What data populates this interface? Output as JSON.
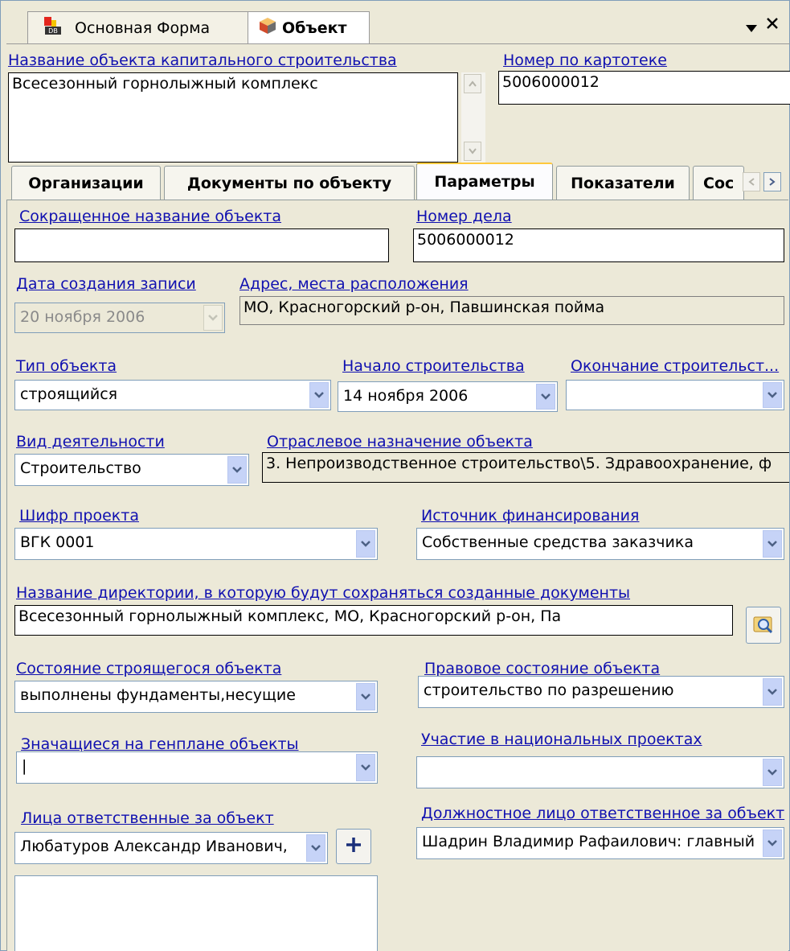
{
  "doc_tabs": [
    {
      "label": "Основная Форма",
      "icon": "database-form-icon"
    },
    {
      "label": "Объект",
      "icon": "cube-icon"
    }
  ],
  "window_controls": {
    "menu_icon": "triangle-down-icon",
    "close_icon": "close-icon"
  },
  "header": {
    "name_label": "Название объекта капитального строительства",
    "name_value": "Всесезонный горнолыжный комплекс",
    "card_label": "Номер по картотеке",
    "card_value": "5006000012"
  },
  "tabs": [
    {
      "label": "Организации"
    },
    {
      "label": "Документы по объекту"
    },
    {
      "label": "Параметры",
      "active": true
    },
    {
      "label": "Показатели"
    },
    {
      "label": "Сос"
    }
  ],
  "form": {
    "short_name": {
      "label": "Сокращенное название объекта",
      "value": ""
    },
    "case_number": {
      "label": "Номер дела",
      "value": "5006000012"
    },
    "created_date": {
      "label": "Дата создания записи",
      "value": "20  ноября  2006"
    },
    "address": {
      "label": "Адрес, места расположения",
      "value": "МО, Красногорский р-он, Павшинская пойма"
    },
    "object_type": {
      "label": "Тип объекта",
      "value": "строящийся"
    },
    "start_build": {
      "label": "Начало строительства",
      "value": "14  ноября  2006"
    },
    "end_build": {
      "label": "Окончание строительст...",
      "value": ""
    },
    "activity": {
      "label": "Вид деятельности",
      "value": "Строительство"
    },
    "branch": {
      "label": "Отраслевое назначение объекта",
      "value": "3. Непроизводственное строительство\\5. Здравоохранение, ф"
    },
    "project_code": {
      "label": "Шифр проекта",
      "value": "ВГК 0001"
    },
    "funding": {
      "label": "Источник финансирования",
      "value": "Собственные средства заказчика"
    },
    "directory": {
      "label": "Название директории, в которую будут сохраняться созданные документы",
      "value": "Всесезонный горнолыжный комплекс, МО, Красногорский р-он, Па"
    },
    "build_state": {
      "label": "Состояние строящегося объекта",
      "value": "выполнены фундаменты,несущие"
    },
    "legal_state": {
      "label": "Правовое состояние объекта",
      "value": "строительство по разрешению"
    },
    "master_plan": {
      "label": "Значащиеся на генплане объекты",
      "value": "|"
    },
    "national": {
      "label": "Участие в национальных проектах",
      "value": ""
    },
    "responsible": {
      "label": "Лица ответственные за объект",
      "value": "Любатуров Александр Иванович,"
    },
    "official": {
      "label": "Должностное лицо ответственное за объект",
      "value": "Шадрин Владимир Рафаилович:  главный"
    }
  },
  "colors": {
    "accent": "#1010b0",
    "tab_highlight": "#ffc83c",
    "window_bg": "#ece9d8"
  }
}
